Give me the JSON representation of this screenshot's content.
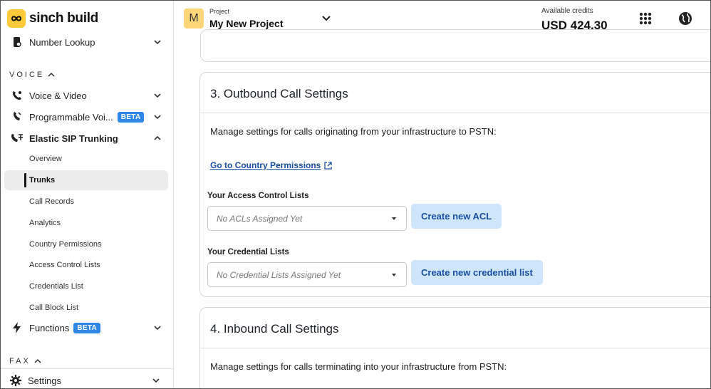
{
  "brand": {
    "name": "sinch build",
    "accent": "#ffc93c"
  },
  "sidebar": {
    "top_item": {
      "label": "Number Lookup",
      "icon": "phone-lookup-icon"
    },
    "voice_section": "VOICE",
    "voice_items": [
      {
        "label": "Voice & Video",
        "icon": "voice-icon"
      },
      {
        "label": "Programmable Voi...",
        "icon": "programmable-voice-icon",
        "badge": "BETA"
      },
      {
        "label": "Elastic SIP Trunking",
        "icon": "sip-icon"
      }
    ],
    "sip_subitems": [
      "Overview",
      "Trunks",
      "Call Records",
      "Analytics",
      "Country Permissions",
      "Access Control Lists",
      "Credentials List",
      "Call Block List"
    ],
    "active_subitem": "Trunks",
    "functions": {
      "label": "Functions",
      "badge": "BETA",
      "icon": "lightning-icon"
    },
    "fax_section": "FAX",
    "settings": {
      "label": "Settings",
      "icon": "gear-icon"
    }
  },
  "header": {
    "project_avatar": "M",
    "project_label": "Project",
    "project_name": "My New Project",
    "credits_label": "Available credits",
    "credits_value": "USD 424.30"
  },
  "outbound": {
    "title": "3. Outbound Call Settings",
    "description": "Manage settings for calls originating from your infrastructure to PSTN:",
    "link": "Go to Country Permissions",
    "acl_label": "Your Access Control Lists",
    "acl_placeholder": "No ACLs Assigned Yet",
    "acl_button": "Create new ACL",
    "cred_label": "Your Credential Lists",
    "cred_placeholder": "No Credential Lists Assigned Yet",
    "cred_button": "Create new credential list"
  },
  "inbound": {
    "title": "4. Inbound Call Settings",
    "description": "Manage settings for calls terminating into your infrastructure from PSTN:"
  }
}
